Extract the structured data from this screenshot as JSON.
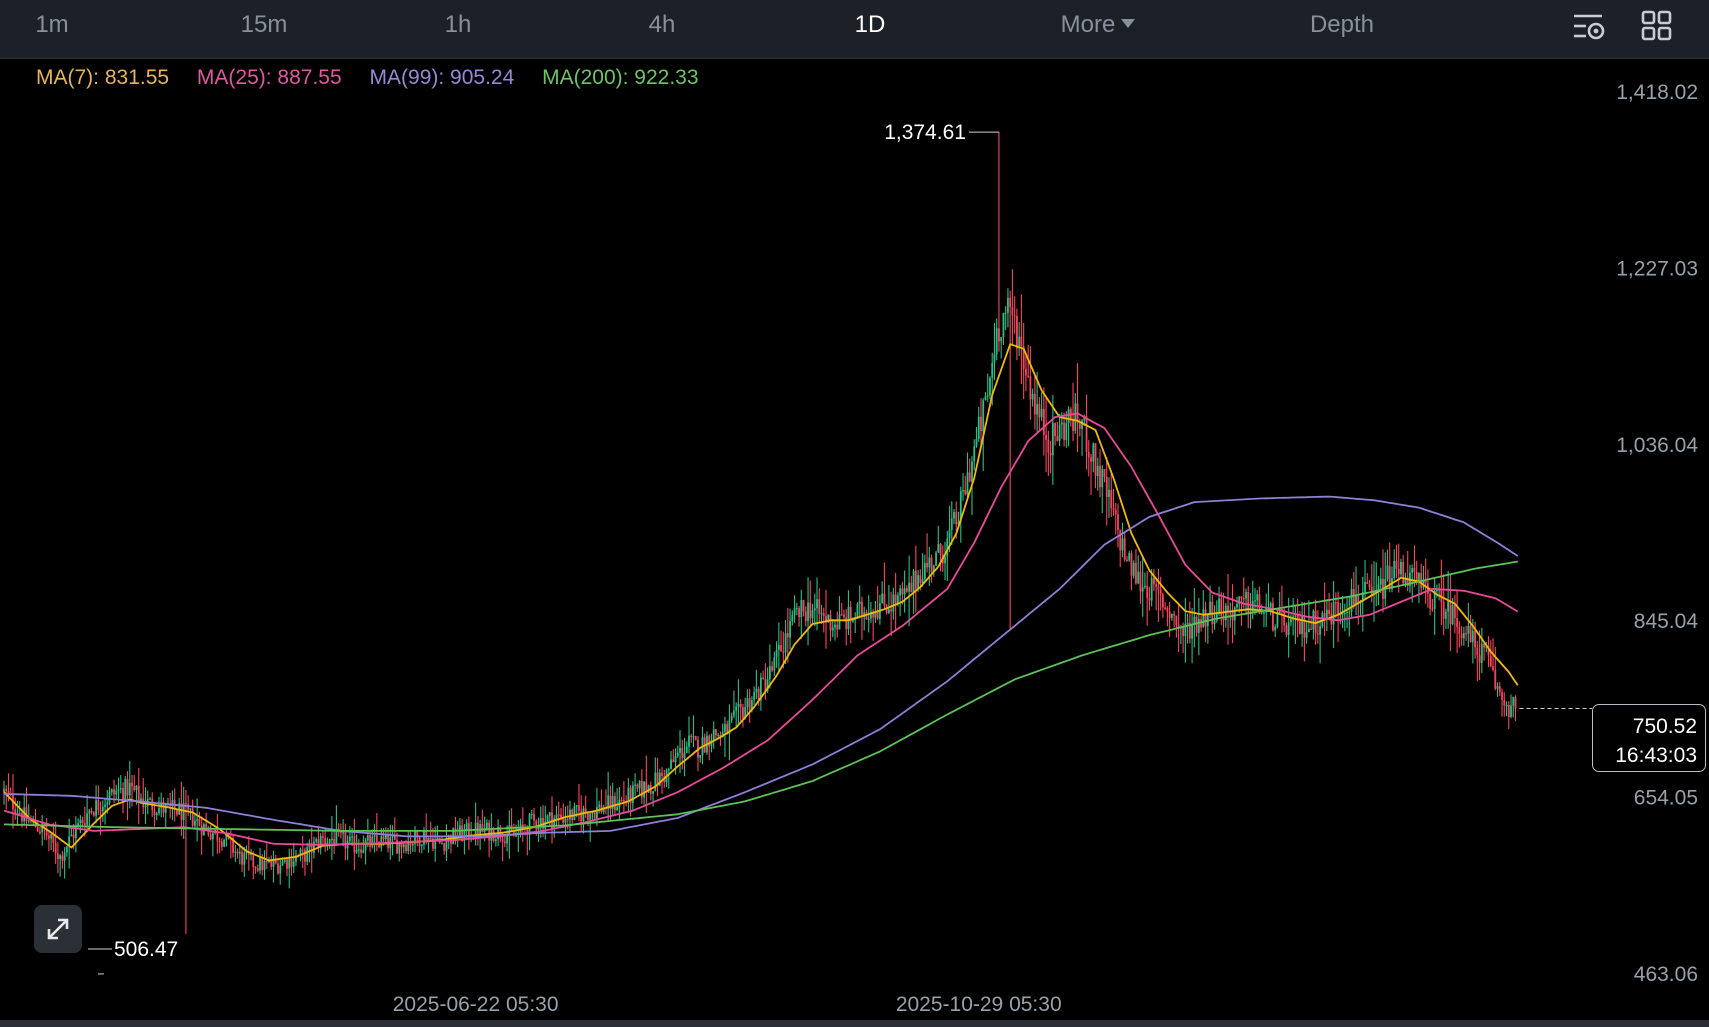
{
  "toolbar": {
    "timeframes": [
      "1m",
      "15m",
      "1h",
      "4h",
      "1D"
    ],
    "active": "1D",
    "more_label": "More",
    "depth_label": "Depth",
    "icons": [
      "chart-settings-icon",
      "grid-layout-icon"
    ]
  },
  "legend": {
    "ma7": "MA(7): 831.55",
    "ma25": "MA(25): 887.55",
    "ma99": "MA(99): 905.24",
    "ma200": "MA(200): 922.33"
  },
  "price_box": {
    "price": "750.52",
    "countdown": "16:43:03"
  },
  "annotations": {
    "high": "1,374.61",
    "low": "506.47"
  },
  "colors": {
    "up": "#2ebd85",
    "down": "#f6465d",
    "ma7": "#f0b90b",
    "ma25": "#e84a99",
    "ma99": "#8f7fd6",
    "ma200": "#5fc05a",
    "ma7_text": "#e8b455",
    "ma25_text": "#e0589f",
    "ma99_text": "#9a86d9",
    "ma200_text": "#6cc463"
  },
  "chart_data": {
    "type": "candlestick",
    "interval": "1D",
    "y_ticks": [
      "1,418.02",
      "1,227.03",
      "1,036.04",
      "845.04",
      "654.05",
      "463.06"
    ],
    "x_ticks": [
      "2025-06-22 05:30",
      "2025-10-29 05:30"
    ],
    "ylim": [
      463.06,
      1418.02
    ],
    "high": 1374.61,
    "low": 506.47,
    "last_price": 750.52,
    "close_path": [
      [
        0,
        660
      ],
      [
        10,
        630
      ],
      [
        18,
        618
      ],
      [
        25,
        590
      ],
      [
        30,
        612
      ],
      [
        38,
        640
      ],
      [
        45,
        652
      ],
      [
        50,
        660
      ],
      [
        56,
        665
      ],
      [
        62,
        650
      ],
      [
        70,
        642
      ],
      [
        78,
        640
      ],
      [
        84,
        632
      ],
      [
        90,
        620
      ],
      [
        98,
        610
      ],
      [
        105,
        590
      ],
      [
        112,
        582
      ],
      [
        120,
        580
      ],
      [
        128,
        588
      ],
      [
        134,
        592
      ],
      [
        141,
        608
      ],
      [
        148,
        610
      ],
      [
        155,
        602
      ],
      [
        162,
        604
      ],
      [
        168,
        606
      ],
      [
        175,
        604
      ],
      [
        182,
        608
      ],
      [
        187,
        614
      ],
      [
        194,
        604
      ],
      [
        200,
        612
      ],
      [
        206,
        616
      ],
      [
        212,
        618
      ],
      [
        220,
        617
      ],
      [
        228,
        612
      ],
      [
        234,
        626
      ],
      [
        240,
        630
      ],
      [
        246,
        632
      ],
      [
        253,
        635
      ],
      [
        262,
        640
      ],
      [
        268,
        645
      ],
      [
        275,
        650
      ],
      [
        282,
        660
      ],
      [
        288,
        668
      ],
      [
        295,
        680
      ],
      [
        300,
        700
      ],
      [
        305,
        712
      ],
      [
        310,
        708
      ],
      [
        315,
        724
      ],
      [
        320,
        722
      ],
      [
        326,
        740
      ],
      [
        332,
        760
      ],
      [
        337,
        772
      ],
      [
        342,
        792
      ],
      [
        347,
        822
      ],
      [
        353,
        852
      ],
      [
        359,
        860
      ],
      [
        364,
        850
      ],
      [
        370,
        842
      ],
      [
        377,
        848
      ],
      [
        384,
        858
      ],
      [
        390,
        862
      ],
      [
        396,
        866
      ],
      [
        402,
        872
      ],
      [
        408,
        900
      ],
      [
        415,
        912
      ],
      [
        420,
        930
      ],
      [
        425,
        960
      ],
      [
        430,
        1010
      ],
      [
        434,
        1050
      ],
      [
        438,
        1090
      ],
      [
        442,
        1160
      ],
      [
        446,
        1180
      ],
      [
        450,
        1170
      ],
      [
        454,
        1130
      ],
      [
        458,
        1090
      ],
      [
        462,
        1060
      ],
      [
        466,
        1040
      ],
      [
        470,
        1050
      ],
      [
        475,
        1065
      ],
      [
        480,
        1060
      ],
      [
        485,
        1020
      ],
      [
        490,
        990
      ],
      [
        495,
        950
      ],
      [
        500,
        910
      ],
      [
        505,
        890
      ],
      [
        510,
        880
      ],
      [
        515,
        870
      ],
      [
        520,
        852
      ],
      [
        525,
        832
      ],
      [
        530,
        844
      ],
      [
        535,
        852
      ],
      [
        540,
        860
      ],
      [
        545,
        856
      ],
      [
        550,
        860
      ],
      [
        556,
        866
      ],
      [
        560,
        858
      ],
      [
        565,
        848
      ],
      [
        570,
        842
      ],
      [
        575,
        838
      ],
      [
        580,
        840
      ],
      [
        585,
        845
      ],
      [
        590,
        852
      ],
      [
        595,
        862
      ],
      [
        600,
        870
      ],
      [
        605,
        874
      ],
      [
        610,
        868
      ],
      [
        615,
        888
      ],
      [
        620,
        900
      ],
      [
        625,
        896
      ],
      [
        630,
        884
      ],
      [
        635,
        872
      ],
      [
        640,
        864
      ],
      [
        645,
        852
      ],
      [
        650,
        836
      ],
      [
        655,
        818
      ],
      [
        660,
        806
      ],
      [
        665,
        770
      ],
      [
        669,
        755
      ],
      [
        673,
        750.52
      ]
    ],
    "ma_series": {
      "MA(7)": [
        [
          0,
          660
        ],
        [
          12,
          630
        ],
        [
          20,
          618
        ],
        [
          30,
          600
        ],
        [
          40,
          626
        ],
        [
          48,
          645
        ],
        [
          56,
          652
        ],
        [
          62,
          648
        ],
        [
          72,
          644
        ],
        [
          84,
          638
        ],
        [
          96,
          620
        ],
        [
          108,
          596
        ],
        [
          118,
          586
        ],
        [
          130,
          590
        ],
        [
          142,
          602
        ],
        [
          154,
          604
        ],
        [
          168,
          604
        ],
        [
          182,
          606
        ],
        [
          194,
          608
        ],
        [
          208,
          613
        ],
        [
          222,
          616
        ],
        [
          236,
          622
        ],
        [
          250,
          633
        ],
        [
          264,
          640
        ],
        [
          278,
          650
        ],
        [
          290,
          666
        ],
        [
          300,
          688
        ],
        [
          310,
          708
        ],
        [
          318,
          718
        ],
        [
          326,
          730
        ],
        [
          334,
          752
        ],
        [
          344,
          786
        ],
        [
          352,
          820
        ],
        [
          360,
          842
        ],
        [
          368,
          846
        ],
        [
          376,
          846
        ],
        [
          384,
          852
        ],
        [
          392,
          858
        ],
        [
          400,
          866
        ],
        [
          408,
          882
        ],
        [
          416,
          904
        ],
        [
          424,
          940
        ],
        [
          432,
          1000
        ],
        [
          440,
          1090
        ],
        [
          448,
          1145
        ],
        [
          454,
          1140
        ],
        [
          462,
          1095
        ],
        [
          470,
          1066
        ],
        [
          478,
          1062
        ],
        [
          486,
          1052
        ],
        [
          494,
          1000
        ],
        [
          502,
          940
        ],
        [
          510,
          900
        ],
        [
          518,
          876
        ],
        [
          526,
          856
        ],
        [
          534,
          852
        ],
        [
          544,
          855
        ],
        [
          554,
          858
        ],
        [
          564,
          856
        ],
        [
          574,
          848
        ],
        [
          584,
          843
        ],
        [
          594,
          852
        ],
        [
          604,
          866
        ],
        [
          614,
          880
        ],
        [
          622,
          892
        ],
        [
          630,
          888
        ],
        [
          638,
          874
        ],
        [
          646,
          864
        ],
        [
          654,
          840
        ],
        [
          662,
          812
        ],
        [
          670,
          790
        ],
        [
          675,
          772
        ]
      ],
      "MA(25)": [
        [
          0,
          640
        ],
        [
          20,
          625
        ],
        [
          40,
          618
        ],
        [
          60,
          620
        ],
        [
          80,
          622
        ],
        [
          100,
          615
        ],
        [
          120,
          604
        ],
        [
          140,
          603
        ],
        [
          160,
          604
        ],
        [
          180,
          606
        ],
        [
          200,
          608
        ],
        [
          220,
          612
        ],
        [
          240,
          618
        ],
        [
          260,
          628
        ],
        [
          280,
          640
        ],
        [
          300,
          660
        ],
        [
          320,
          686
        ],
        [
          340,
          716
        ],
        [
          360,
          760
        ],
        [
          380,
          808
        ],
        [
          400,
          840
        ],
        [
          420,
          880
        ],
        [
          432,
          930
        ],
        [
          444,
          990
        ],
        [
          456,
          1040
        ],
        [
          468,
          1066
        ],
        [
          478,
          1070
        ],
        [
          490,
          1054
        ],
        [
          502,
          1012
        ],
        [
          514,
          960
        ],
        [
          526,
          906
        ],
        [
          538,
          876
        ],
        [
          552,
          864
        ],
        [
          566,
          858
        ],
        [
          580,
          850
        ],
        [
          594,
          846
        ],
        [
          608,
          852
        ],
        [
          622,
          866
        ],
        [
          636,
          880
        ],
        [
          650,
          878
        ],
        [
          664,
          870
        ],
        [
          675,
          854
        ]
      ],
      "MA(99)": [
        [
          0,
          658
        ],
        [
          30,
          656
        ],
        [
          60,
          650
        ],
        [
          90,
          643
        ],
        [
          120,
          630
        ],
        [
          150,
          618
        ],
        [
          180,
          612
        ],
        [
          210,
          612
        ],
        [
          240,
          616
        ],
        [
          270,
          618
        ],
        [
          300,
          632
        ],
        [
          330,
          660
        ],
        [
          360,
          690
        ],
        [
          390,
          728
        ],
        [
          420,
          780
        ],
        [
          450,
          840
        ],
        [
          470,
          880
        ],
        [
          490,
          928
        ],
        [
          510,
          958
        ],
        [
          530,
          974
        ],
        [
          560,
          978
        ],
        [
          590,
          980
        ],
        [
          610,
          976
        ],
        [
          630,
          968
        ],
        [
          650,
          952
        ],
        [
          665,
          930
        ],
        [
          675,
          914
        ]
      ],
      "MA(200)": [
        [
          0,
          625
        ],
        [
          50,
          622
        ],
        [
          100,
          620
        ],
        [
          150,
          618
        ],
        [
          200,
          618
        ],
        [
          250,
          624
        ],
        [
          300,
          636
        ],
        [
          330,
          650
        ],
        [
          360,
          672
        ],
        [
          390,
          704
        ],
        [
          420,
          744
        ],
        [
          450,
          782
        ],
        [
          480,
          808
        ],
        [
          510,
          830
        ],
        [
          540,
          848
        ],
        [
          570,
          860
        ],
        [
          600,
          872
        ],
        [
          630,
          888
        ],
        [
          655,
          902
        ],
        [
          675,
          910
        ]
      ]
    },
    "x_tick_positions": [
      210,
      434
    ],
    "y_axis_label_positions": [
      1418.02,
      1227.03,
      1036.04,
      845.04,
      654.05,
      463.06
    ]
  }
}
